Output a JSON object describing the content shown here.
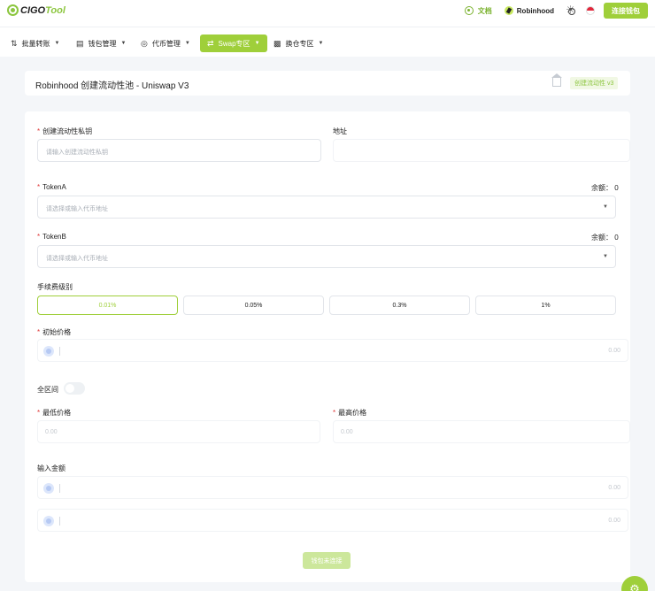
{
  "brand": {
    "logo_left": "CIGO",
    "logo_right": "Tool"
  },
  "topbar": {
    "docs_label": "文档",
    "chain_label": "Robinhood",
    "connect_label": "连接钱包"
  },
  "nav": {
    "items": [
      {
        "label": "批量转账",
        "icon": "transfer-icon"
      },
      {
        "label": "钱包管理",
        "icon": "wallet-icon"
      },
      {
        "label": "代币管理",
        "icon": "token-icon"
      },
      {
        "label": "Swap专区",
        "icon": "swap-icon"
      },
      {
        "label": "换仓专区",
        "icon": "blocks-icon"
      }
    ],
    "active_index": 3
  },
  "header": {
    "title": "Robinhood 创建流动性池 - Uniswap V3",
    "tag": "创建流动性 v3"
  },
  "form": {
    "private_key_label": "创建流动性私钥",
    "private_key_placeholder": "请输入创建流动性私钥",
    "address_label": "地址",
    "token_a_label": "TokenA",
    "token_a_placeholder": "请选择或输入代币地址",
    "token_a_balance": "余额： 0",
    "token_b_label": "TokenB",
    "token_b_placeholder": "请选择或输入代币地址",
    "token_b_balance": "余额： 0",
    "fee_label": "手续费级别",
    "fees": [
      "0.01%",
      "0.05%",
      "0.3%",
      "1%"
    ],
    "fee_selected": "0.01%",
    "initial_price_label": "初始价格",
    "initial_price_value": "0.00",
    "full_range_label": "全区间",
    "min_price_label": "最低价格",
    "min_price_value": "0.00",
    "max_price_label": "最高价格",
    "max_price_value": "0.00",
    "amount_label": "输入金额",
    "amount_a_value": "0.00",
    "amount_b_value": "0.00",
    "submit_label": "钱包未连接"
  },
  "colors": {
    "accent": "#9fcf3a",
    "required": "#e03a3a",
    "text": "#222222"
  }
}
